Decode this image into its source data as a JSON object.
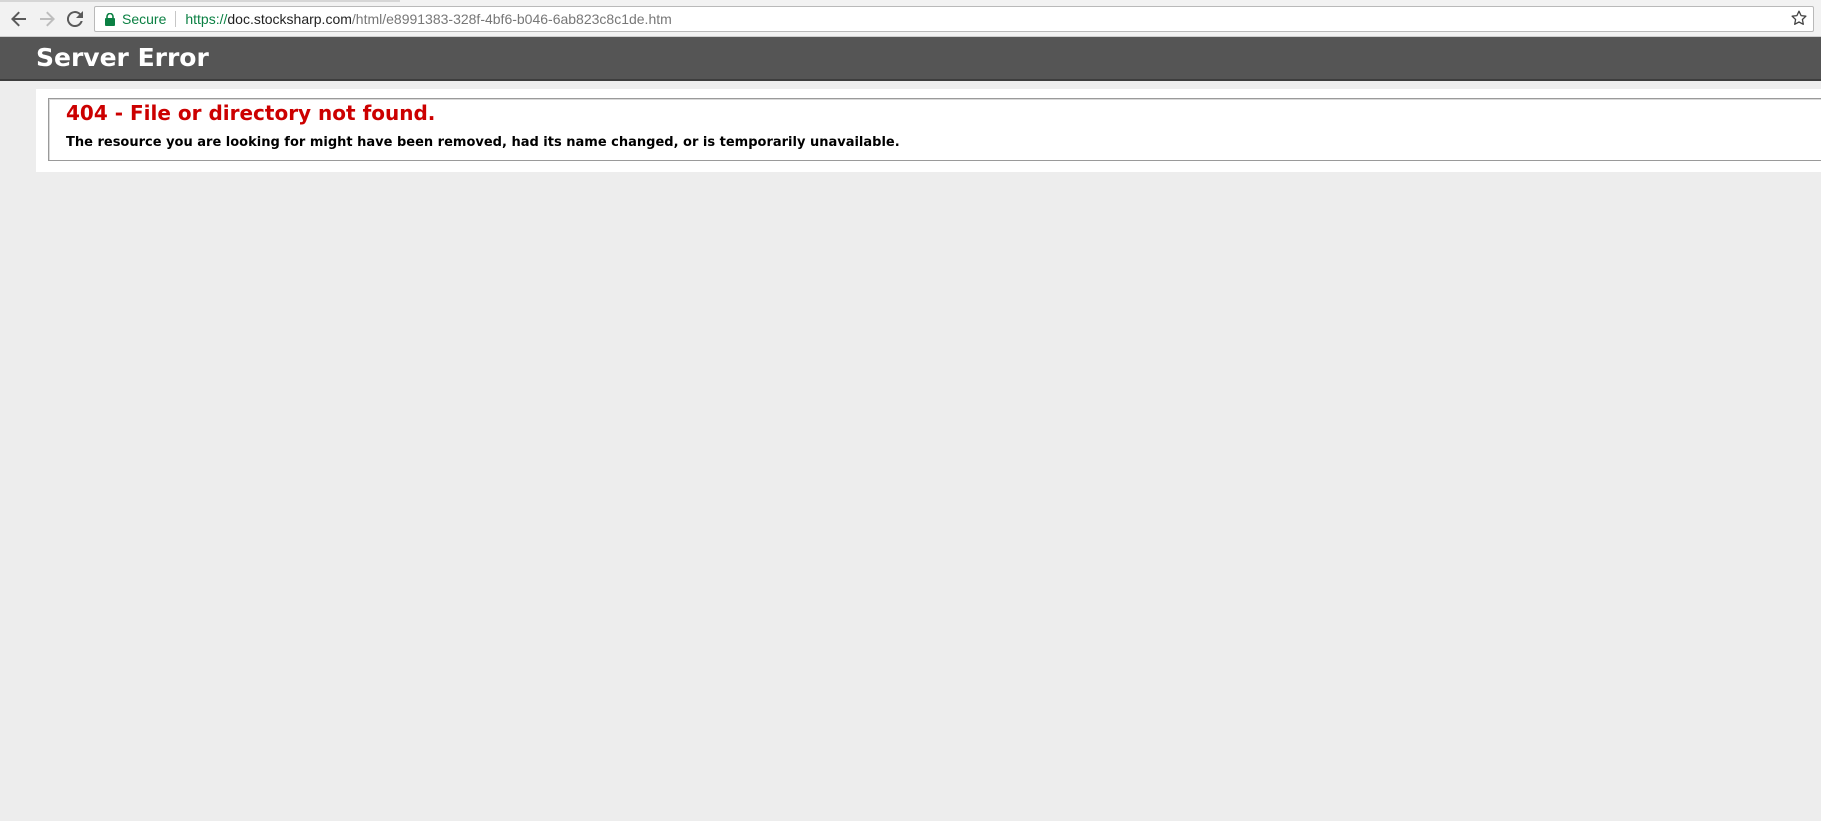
{
  "browser": {
    "secure_label": "Secure",
    "url": {
      "scheme": "https://",
      "host": "doc.stocksharp.com",
      "path": "/html/e8991383-328f-4bf6-b046-6ab823c8c1de.htm"
    },
    "icons": {
      "back": "arrow-left-icon",
      "forward": "arrow-right-icon",
      "reload": "reload-icon",
      "lock": "lock-icon",
      "bookmark": "star-icon"
    }
  },
  "page": {
    "header_title": "Server Error",
    "error_title": "404 - File or directory not found.",
    "error_description": "The resource you are looking for might have been removed, had its name changed, or is temporarily unavailable."
  },
  "colors": {
    "header_background": "#555555",
    "error_title": "#cc0000",
    "secure": "#0b8043",
    "page_background": "#ededed"
  }
}
